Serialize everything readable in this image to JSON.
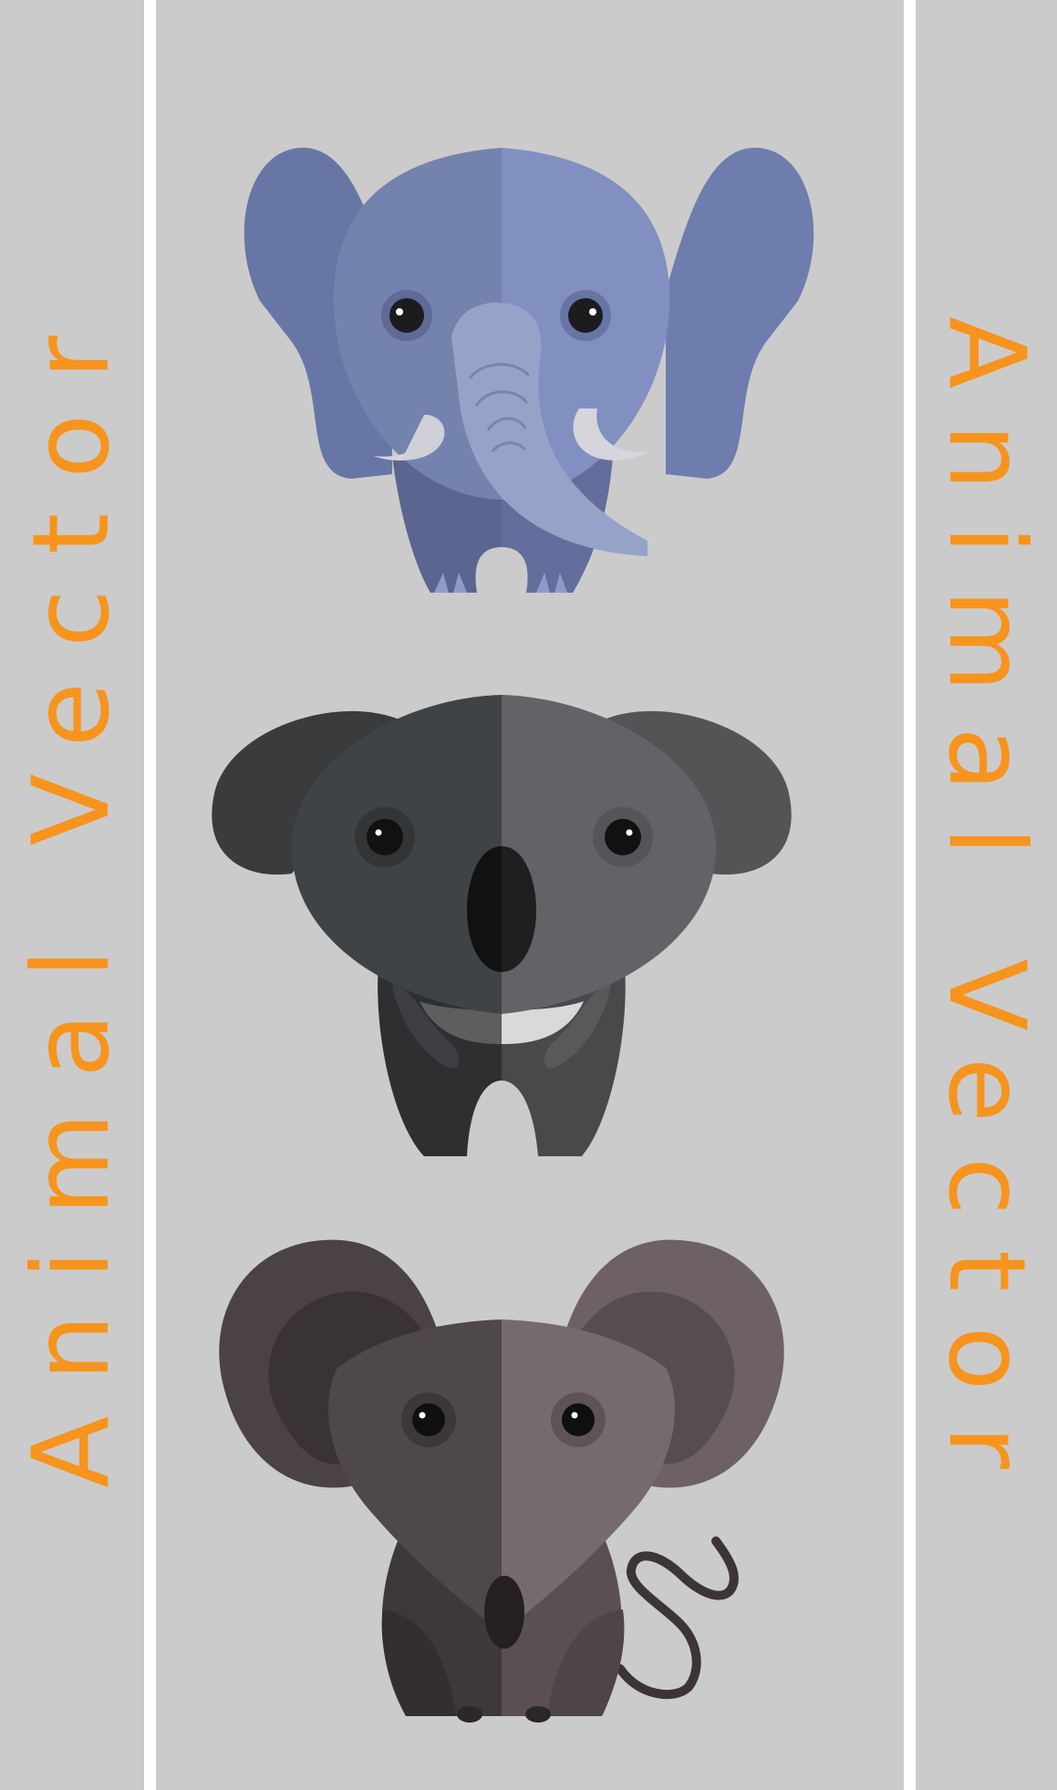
{
  "poster": {
    "left_title": "Animal Vector",
    "right_title": "Animal Vector"
  },
  "animals": [
    {
      "name": "elephant",
      "icon": "elephant-icon"
    },
    {
      "name": "koala",
      "icon": "koala-icon"
    },
    {
      "name": "mouse",
      "icon": "mouse-icon"
    }
  ],
  "colors": {
    "panel": "#cbcbcb",
    "divider": "#ffffff",
    "title": "#f7941d",
    "elephant": "#7b8dbf",
    "koala": "#4c4e52",
    "mouse": "#5e5459"
  }
}
